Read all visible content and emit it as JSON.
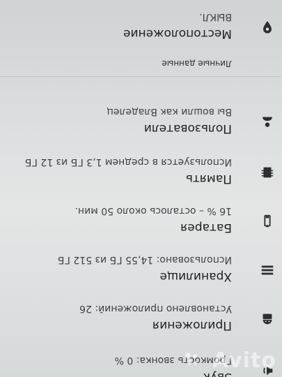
{
  "settings": {
    "items": [
      {
        "icon": "volume-icon",
        "title": "Звук",
        "subtitle": "Громкость звонка: 0 %"
      },
      {
        "icon": "android-icon",
        "title": "Приложения",
        "subtitle": "Установлено приложений: 26"
      },
      {
        "icon": "storage-icon",
        "title": "Хранилище",
        "subtitle": "Использовано: 14,55 ГБ из 512 ГБ"
      },
      {
        "icon": "battery-icon",
        "title": "Батарея",
        "subtitle": "16 % – осталось около 50 мин."
      },
      {
        "icon": "memory-icon",
        "title": "Память",
        "subtitle": "Используется в среднем 1,3 ГБ из 12 ГБ"
      },
      {
        "icon": "user-icon",
        "title": "Пользователи",
        "subtitle": "Вы вошли как Владелец"
      }
    ],
    "personal_section": {
      "header": "Личные данные",
      "items": [
        {
          "icon": "location-icon",
          "title": "Местоположение",
          "subtitle": "ВЫКЛ."
        }
      ]
    }
  },
  "watermark": {
    "text": "Avito"
  },
  "colors": {
    "text_primary": "#1f1f1f",
    "text_secondary": "#3f4244",
    "icon": "#2c2f30"
  }
}
